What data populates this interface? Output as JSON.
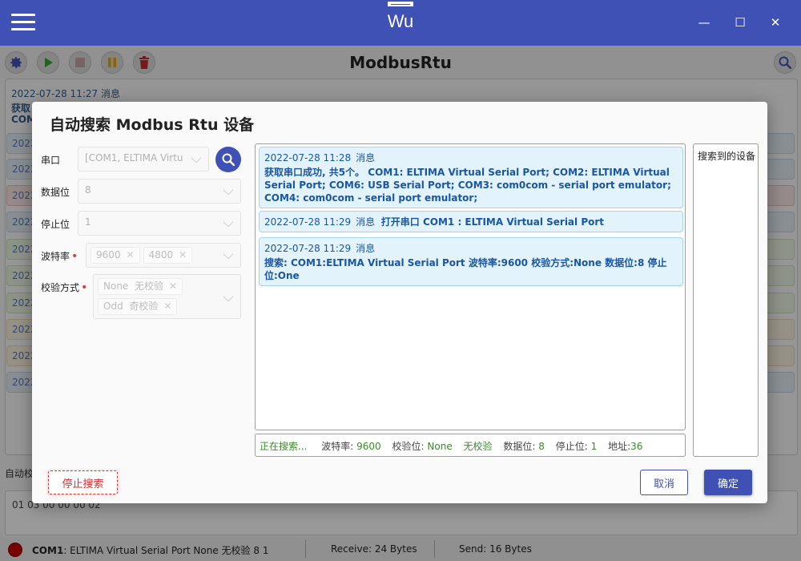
{
  "window": {
    "title": "Wu",
    "minimize": "—",
    "maximize": "☐",
    "close": "✕"
  },
  "toolbar": {
    "page_title": "ModbusRtu"
  },
  "background": {
    "first_entry_time": "2022-07-28 11:27  消息",
    "first_entry_line1": "获取",
    "first_entry_line2": "COM",
    "entry_prefix": "2022",
    "auto_check_label": "自动校",
    "command_value": "01 03 00 00 00 02"
  },
  "statusbar": {
    "port": "COM1",
    "port_desc": ": ELTIMA Virtual Serial Port  None   无校验  8  1",
    "receive": "Receive: 24 Bytes",
    "send": "Send: 16 Bytes"
  },
  "dialog": {
    "title": "自动搜索 Modbus Rtu 设备",
    "form": {
      "port_label": "串口",
      "port_value": "[COM1, ELTIMA Virtu",
      "databits_label": "数据位",
      "databits_value": "8",
      "stopbits_label": "停止位",
      "stopbits_value": "1",
      "baud_label": "波特率",
      "baud_tags": [
        "9600",
        "4800"
      ],
      "parity_label": "校验方式",
      "parity_tags": [
        {
          "code": "None",
          "name": "无校验"
        },
        {
          "code": "Odd",
          "name": "奇校验"
        }
      ],
      "required_mark": "•"
    },
    "log": [
      {
        "time": "2022-07-28 11:28",
        "kind": "消息",
        "text": "获取串口成功, 共5个。  COM1: ELTIMA Virtual Serial Port;   COM2: ELTIMA Virtual Serial Port;   COM6: USB Serial Port;   COM3: com0com - serial port emulator;   COM4: com0com - serial port emulator;"
      },
      {
        "time": "2022-07-28 11:29",
        "kind": "消息",
        "text": "打开串口 COM1 : ELTIMA Virtual Serial Port"
      },
      {
        "time": "2022-07-28 11:29",
        "kind": "消息",
        "text": "搜索: COM1:ELTIMA Virtual Serial Port 波特率:9600 校验方式:None 数据位:8 停止位:One"
      }
    ],
    "status": {
      "searching": "正在搜索...",
      "baud_label": "波特率:",
      "baud_value": "9600",
      "parity_label": "校验位:",
      "parity_value": "None",
      "parity_name": "无校验",
      "databits_label": "数据位:",
      "databits_value": "8",
      "stopbits_label": "停止位:",
      "stopbits_value": "1",
      "address_label": "地址:",
      "address_value": "36"
    },
    "devices_title": "搜索到的设备",
    "stop_button": "停止搜索",
    "cancel_button": "取消",
    "ok_button": "确定"
  },
  "colors": {
    "primary": "#3f51b5",
    "danger": "#d32f2f",
    "log_text": "#1a55a6",
    "status_green": "#3a8a2a"
  }
}
